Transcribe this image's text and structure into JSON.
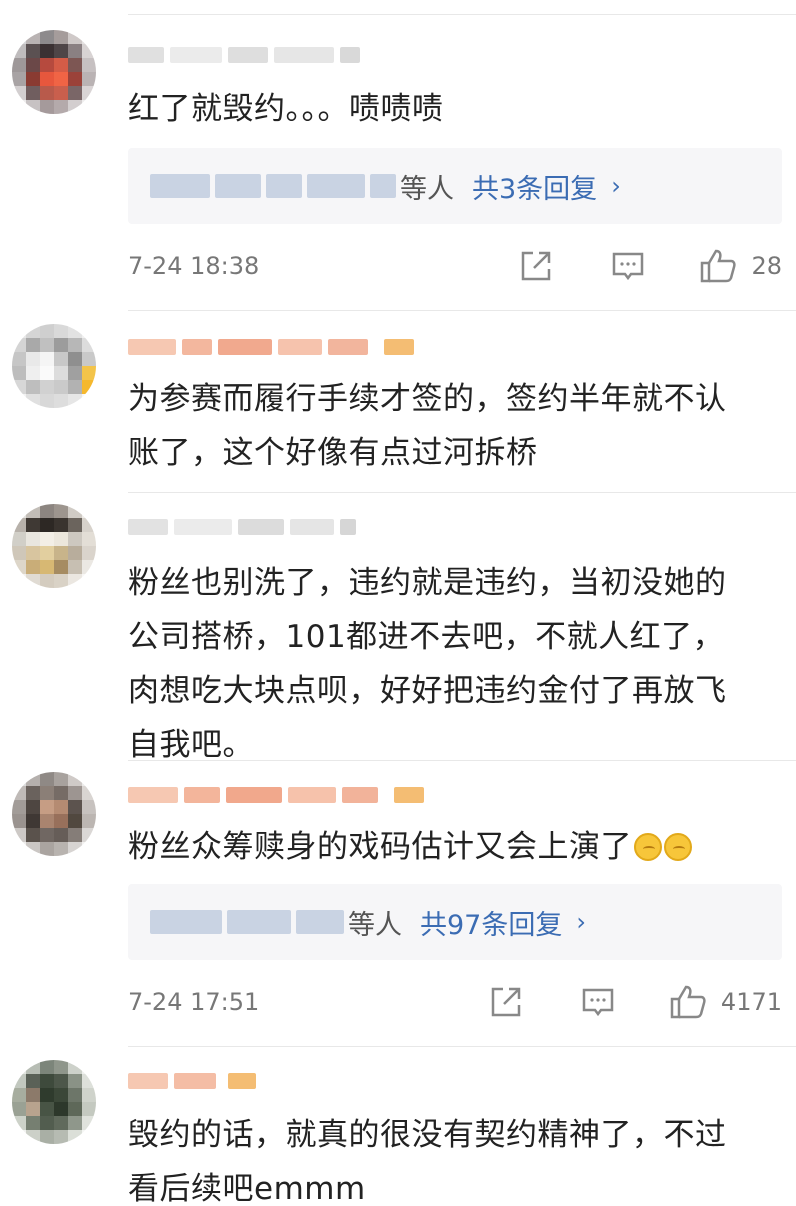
{
  "comments": [
    {
      "text": "红了就毁约。。。啧啧啧",
      "replies": {
        "suffix": "等人",
        "count_label": "共3条回复",
        "chevron": "›"
      },
      "time": "7-24 18:38",
      "likes": "28"
    },
    {
      "text_lines": [
        "为参赛而履行手续才签的，签约半年就不认",
        "账了，这个好像有点过河拆桥"
      ]
    },
    {
      "text_lines": [
        "粉丝也别洗了，违约就是违约，当初没她的",
        "公司搭桥，101都进不去吧，不就人红了，",
        "肉想吃大块点呗，好好把违约金付了再放飞",
        "自我吧。"
      ]
    },
    {
      "text": "粉丝众筹赎身的戏码估计又会上演了",
      "emoji": "thinking-face",
      "replies": {
        "suffix": "等人",
        "count_label": "共97条回复",
        "chevron": "›"
      },
      "time": "7-24 17:51",
      "likes": "4171"
    },
    {
      "text_lines": [
        "毁约的话，就真的很没有契约精神了，不过",
        "看后续吧emmm"
      ]
    }
  ],
  "icons": {
    "share": "share-icon",
    "comment": "comment-icon",
    "like": "thumbs-up-icon"
  },
  "colors": {
    "link": "#3b6cb3",
    "reply_bg": "#f6f6f8",
    "meta": "#777777"
  }
}
